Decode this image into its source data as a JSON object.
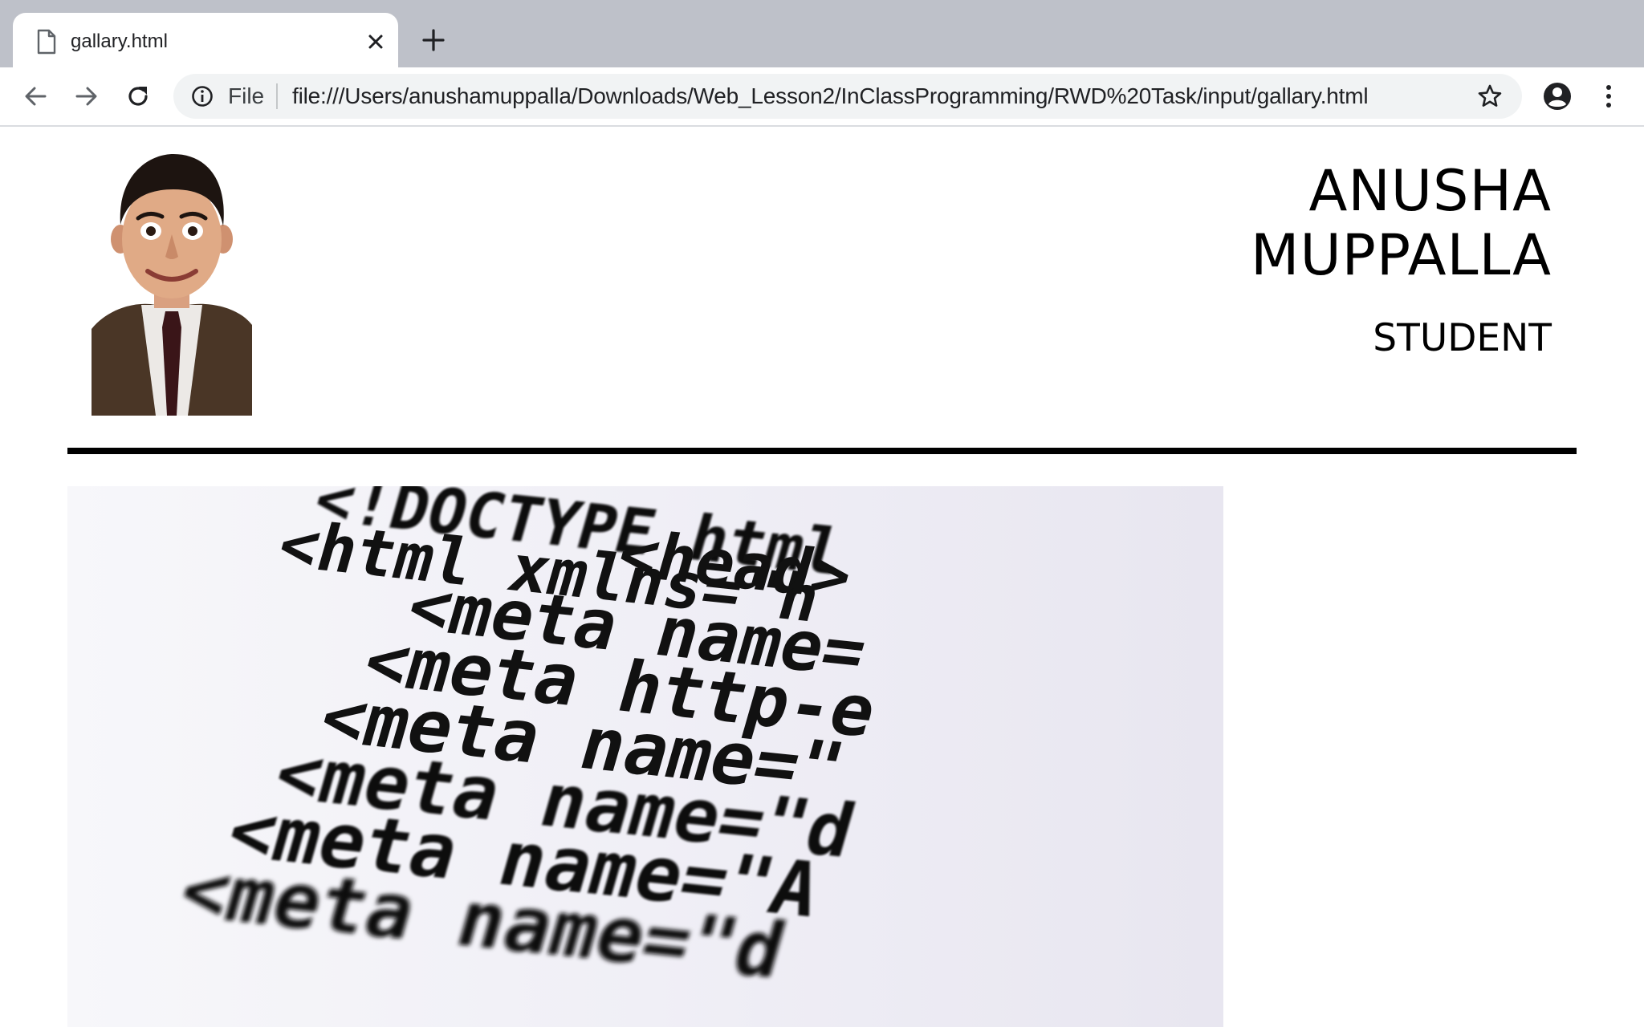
{
  "browser": {
    "tab": {
      "title": "gallary.html",
      "icon": "document-icon"
    },
    "new_tab_icon": "plus-icon",
    "omnibox": {
      "scheme_label": "File",
      "url": "file:///Users/anushamuppalla/Downloads/Web_Lesson2/InClassProgramming/RWD%20Task/input/gallary.html"
    },
    "colors": {
      "tabstrip": "#bec1c9",
      "omnibox": "#f1f3f4"
    }
  },
  "page": {
    "name_first": "ANUSHA",
    "name_last": "MUPPALLA",
    "role": "STUDENT",
    "code_lines": [
      "<!DOCTYPE html",
      "<html xmlns=\"h",
      "<head>",
      "<meta name=",
      "<meta http-e",
      "<meta name=\"",
      "<meta name=\"d",
      "<meta name=\"A",
      "<meta name=\"d"
    ]
  }
}
